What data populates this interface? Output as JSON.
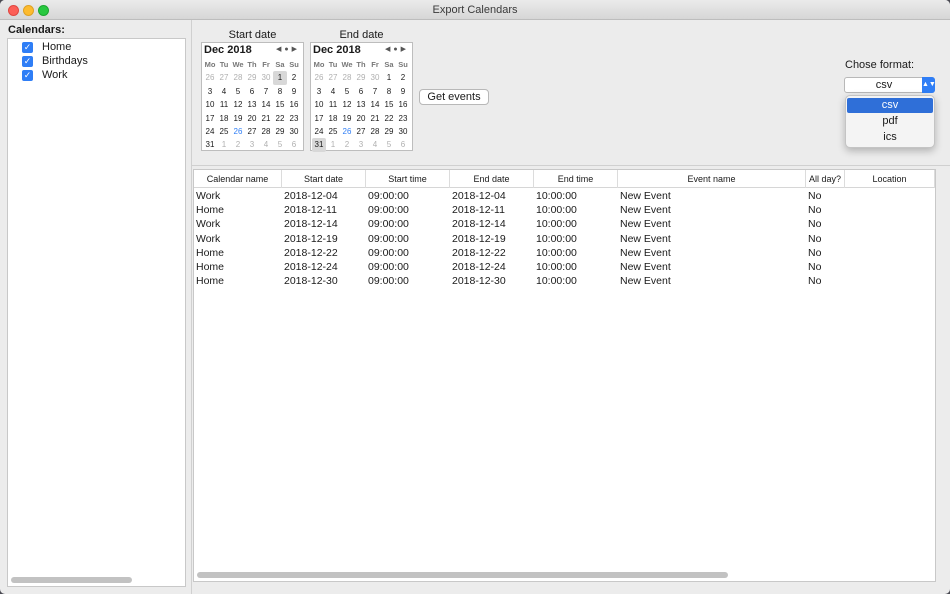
{
  "window": {
    "title": "Export Calendars"
  },
  "sidebar": {
    "label": "Calendars:",
    "items": [
      {
        "label": "Home",
        "checked": true
      },
      {
        "label": "Birthdays",
        "checked": true
      },
      {
        "label": "Work",
        "checked": true
      }
    ]
  },
  "start_date": {
    "label": "Start date",
    "month": "Dec 2018",
    "weekdays": [
      "Mo",
      "Tu",
      "We",
      "Th",
      "Fr",
      "Sa",
      "Su"
    ],
    "days": [
      "26",
      "27",
      "28",
      "29",
      "30",
      "1",
      "2",
      "3",
      "4",
      "5",
      "6",
      "7",
      "8",
      "9",
      "10",
      "11",
      "12",
      "13",
      "14",
      "15",
      "16",
      "17",
      "18",
      "19",
      "20",
      "21",
      "22",
      "23",
      "24",
      "25",
      "26",
      "27",
      "28",
      "29",
      "30",
      "31",
      "1",
      "2",
      "3",
      "4",
      "5",
      "6"
    ],
    "selected": "1"
  },
  "end_date": {
    "label": "End date",
    "month": "Dec 2018",
    "weekdays": [
      "Mo",
      "Tu",
      "We",
      "Th",
      "Fr",
      "Sa",
      "Su"
    ],
    "days": [
      "26",
      "27",
      "28",
      "29",
      "30",
      "1",
      "2",
      "3",
      "4",
      "5",
      "6",
      "7",
      "8",
      "9",
      "10",
      "11",
      "12",
      "13",
      "14",
      "15",
      "16",
      "17",
      "18",
      "19",
      "20",
      "21",
      "22",
      "23",
      "24",
      "25",
      "26",
      "27",
      "28",
      "29",
      "30",
      "31",
      "1",
      "2",
      "3",
      "4",
      "5",
      "6"
    ],
    "selected": "31"
  },
  "get_events_label": "Get events",
  "format": {
    "label": "Chose format:",
    "selected": "csv",
    "options": [
      "csv",
      "pdf",
      "ics"
    ]
  },
  "colors": {
    "accent": "#2f7ef6",
    "today": "#2f7ef6"
  },
  "table": {
    "columns": [
      "Calendar name",
      "Start date",
      "Start time",
      "End date",
      "End time",
      "Event name",
      "All day?",
      "Location"
    ],
    "rows": [
      [
        "Work",
        "2018-12-04",
        "09:00:00",
        "2018-12-04",
        "10:00:00",
        "New Event",
        "No",
        ""
      ],
      [
        "Home",
        "2018-12-11",
        "09:00:00",
        "2018-12-11",
        "10:00:00",
        "New Event",
        "No",
        ""
      ],
      [
        "Work",
        "2018-12-14",
        "09:00:00",
        "2018-12-14",
        "10:00:00",
        "New Event",
        "No",
        ""
      ],
      [
        "Work",
        "2018-12-19",
        "09:00:00",
        "2018-12-19",
        "10:00:00",
        "New Event",
        "No",
        ""
      ],
      [
        "Home",
        "2018-12-22",
        "09:00:00",
        "2018-12-22",
        "10:00:00",
        "New Event",
        "No",
        ""
      ],
      [
        "Home",
        "2018-12-24",
        "09:00:00",
        "2018-12-24",
        "10:00:00",
        "New Event",
        "No",
        ""
      ],
      [
        "Home",
        "2018-12-30",
        "09:00:00",
        "2018-12-30",
        "10:00:00",
        "New Event",
        "No",
        ""
      ]
    ]
  }
}
